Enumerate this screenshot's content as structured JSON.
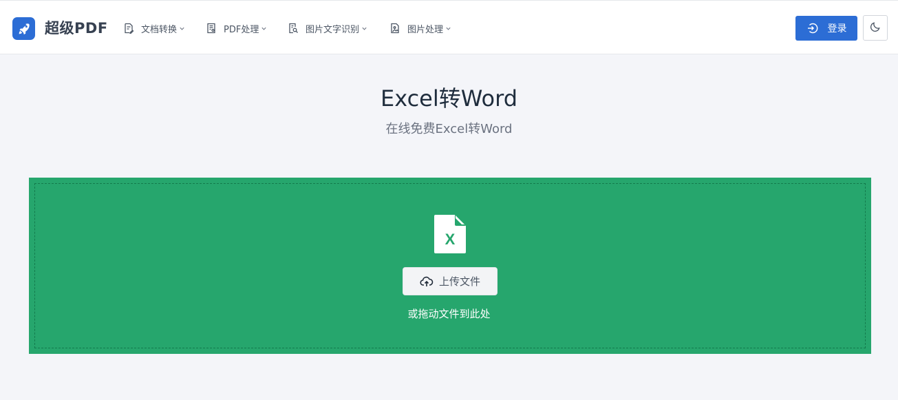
{
  "header": {
    "brand": "超级PDF",
    "logo_icon": "rocket-icon",
    "nav": [
      {
        "label": "文档转换",
        "icon": "document-edit-icon"
      },
      {
        "label": "PDF处理",
        "icon": "pdf-document-icon"
      },
      {
        "label": "图片文字识别",
        "icon": "document-search-icon"
      },
      {
        "label": "图片处理",
        "icon": "image-file-icon"
      }
    ],
    "login_label": "登录",
    "login_icon": "login-icon",
    "theme_icon": "moon-icon"
  },
  "main": {
    "title": "Excel转Word",
    "subtitle": "在线免费Excel转Word",
    "upload": {
      "file_icon": "excel-file-icon",
      "file_icon_letter": "X",
      "button_label": "上传文件",
      "button_icon": "cloud-upload-icon",
      "drag_hint": "或拖动文件到此处"
    }
  },
  "colors": {
    "accent": "#2c6dd5",
    "upload_zone": "#26a66d",
    "background": "#f4f5f9"
  }
}
